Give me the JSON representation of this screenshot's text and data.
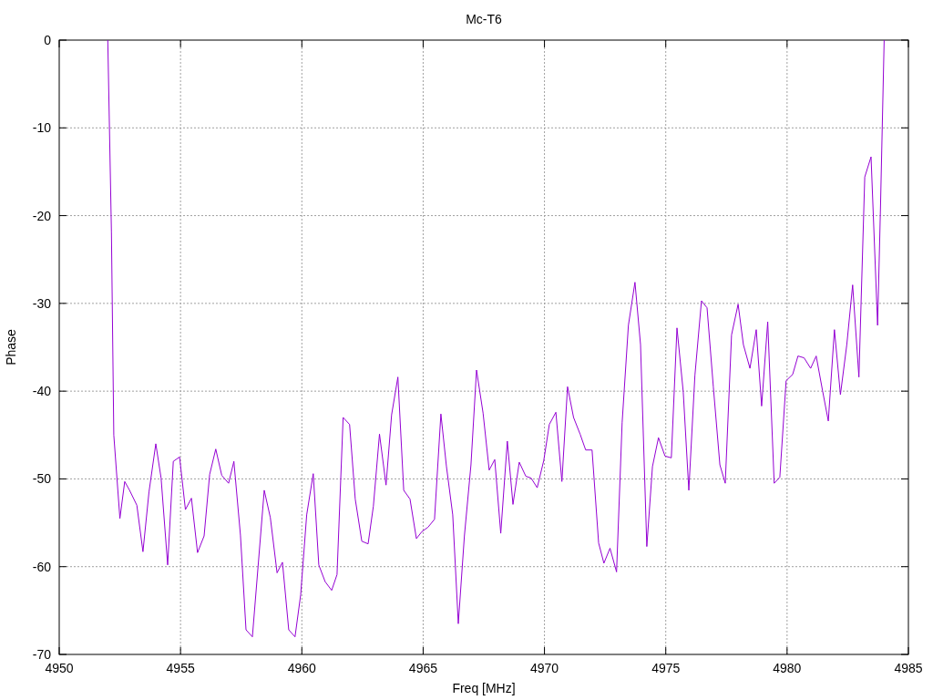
{
  "chart_data": {
    "type": "line",
    "title": "Mc-T6",
    "grid": true,
    "xlabel": "Freq [MHz]",
    "ylabel": "Phase",
    "xlim": [
      4950,
      4985
    ],
    "ylim": [
      -70,
      0
    ],
    "xticks": [
      4950,
      4955,
      4960,
      4965,
      4970,
      4975,
      4980,
      4985
    ],
    "yticks": [
      -70,
      -60,
      -50,
      -40,
      -30,
      -20,
      -10,
      0
    ],
    "x": [
      4952.0,
      4952.15,
      4952.25,
      4952.5,
      4952.7,
      4952.9,
      4953.2,
      4953.45,
      4953.7,
      4953.98,
      4954.2,
      4954.47,
      4954.7,
      4954.96,
      4955.2,
      4955.45,
      4955.7,
      4955.97,
      4956.2,
      4956.45,
      4956.7,
      4956.98,
      4957.2,
      4957.47,
      4957.7,
      4957.96,
      4958.45,
      4958.7,
      4958.98,
      4959.2,
      4959.46,
      4959.72,
      4959.95,
      4960.2,
      4960.47,
      4960.7,
      4960.96,
      4961.23,
      4961.45,
      4961.7,
      4961.97,
      4962.2,
      4962.47,
      4962.73,
      4962.95,
      4963.2,
      4963.47,
      4963.7,
      4963.96,
      4964.2,
      4964.46,
      4964.72,
      4964.95,
      4965.2,
      4965.47,
      4965.73,
      4965.96,
      4966.22,
      4966.45,
      4966.7,
      4966.97,
      4967.2,
      4967.47,
      4967.72,
      4967.95,
      4968.2,
      4968.47,
      4968.7,
      4968.96,
      4969.23,
      4969.45,
      4969.7,
      4969.97,
      4970.2,
      4970.47,
      4970.72,
      4970.95,
      4971.2,
      4971.47,
      4971.7,
      4971.96,
      4972.23,
      4972.45,
      4972.7,
      4972.97,
      4973.2,
      4973.46,
      4973.73,
      4973.96,
      4974.22,
      4974.45,
      4974.7,
      4974.97,
      4975.23,
      4975.46,
      4975.72,
      4975.95,
      4976.2,
      4976.47,
      4976.7,
      4976.96,
      4977.23,
      4977.45,
      4977.71,
      4977.98,
      4978.2,
      4978.47,
      4978.73,
      4978.95,
      4979.2,
      4979.47,
      4979.7,
      4979.96,
      4980.23,
      4980.45,
      4980.7,
      4980.97,
      4981.2,
      4981.46,
      4981.7,
      4981.95,
      4982.2,
      4982.46,
      4982.7,
      4982.96,
      4983.2,
      4983.46,
      4983.73,
      4983.85,
      4984.0
    ],
    "series": [
      {
        "color": "#9400d3",
        "values": [
          0,
          -21.9,
          -45,
          -54.5,
          -50.3,
          -51.3,
          -53,
          -58.3,
          -51.5,
          -46,
          -49.9,
          -59.8,
          -48,
          -47.5,
          -53.5,
          -52.2,
          -58.4,
          -56.5,
          -49.5,
          -46.6,
          -49.6,
          -50.5,
          -48,
          -56.4,
          -67.2,
          -68,
          -51.3,
          -54.4,
          -60.7,
          -59.5,
          -67.2,
          -68,
          -63.2,
          -54.1,
          -49.4,
          -59.8,
          -61.7,
          -62.7,
          -60.9,
          -43,
          -43.8,
          -52.3,
          -57.1,
          -57.4,
          -53.1,
          -44.9,
          -50.7,
          -42.7,
          -38.4,
          -51.3,
          -52.3,
          -56.8,
          -56,
          -55.5,
          -54.6,
          -42.6,
          -48.6,
          -54.1,
          -66.5,
          -56.5,
          -48.4,
          -37.6,
          -42.5,
          -49,
          -47.8,
          -56.2,
          -45.7,
          -52.9,
          -48.1,
          -49.7,
          -49.9,
          -51,
          -47.9,
          -43.8,
          -42.4,
          -50.3,
          -39.5,
          -43,
          -44.9,
          -46.7,
          -46.7,
          -57.3,
          -59.6,
          -57.9,
          -60.6,
          -43.6,
          -32.5,
          -27.6,
          -34.7,
          -57.7,
          -48.6,
          -45.3,
          -47.4,
          -47.6,
          -32.8,
          -40.1,
          -51.3,
          -38.2,
          -29.7,
          -30.5,
          -39.5,
          -48.4,
          -50.5,
          -33.6,
          -30.1,
          -34.7,
          -37.4,
          -33,
          -41.7,
          -32.1,
          -50.5,
          -49.8,
          -38.8,
          -38.1,
          -36,
          -36.2,
          -37.4,
          -36,
          -39.9,
          -43.4,
          -33,
          -40.4,
          -34.7,
          -27.9,
          -38.4,
          -15.6,
          -13.3,
          -32.5,
          -18.9,
          0
        ]
      }
    ]
  }
}
